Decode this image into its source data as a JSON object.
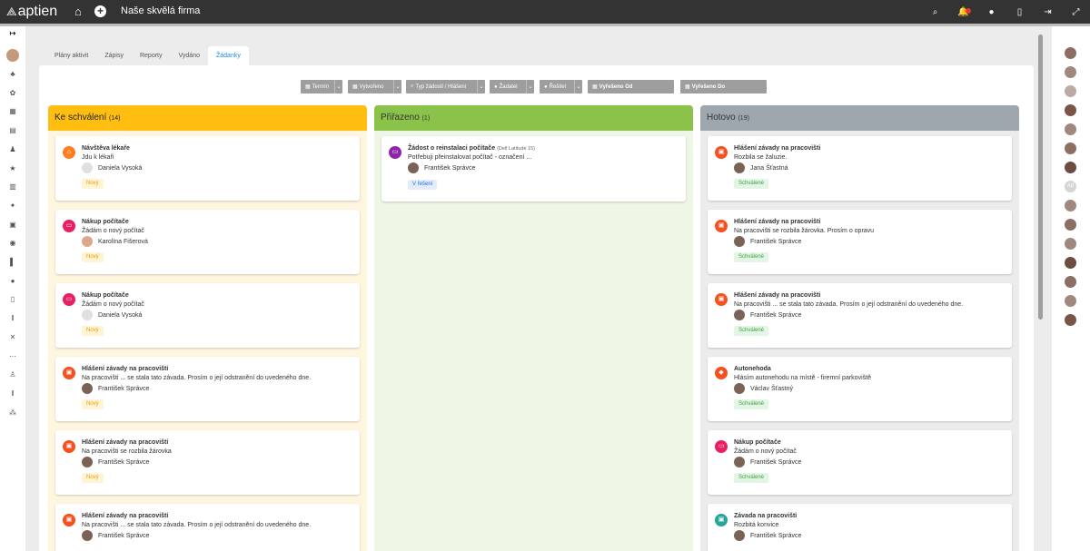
{
  "app": {
    "logo": "aptien",
    "company": "Naše skvělá firma"
  },
  "topbar": {
    "icons": [
      "search-icon",
      "notifications-icon",
      "chat-icon",
      "mobile-icon",
      "logout-icon",
      "fullscreen-icon"
    ]
  },
  "tabs": [
    {
      "label": "Plány aktivit"
    },
    {
      "label": "Zápisy"
    },
    {
      "label": "Reporty"
    },
    {
      "label": "Vydáno"
    },
    {
      "label": "Žádanky",
      "active": true
    }
  ],
  "filters": [
    {
      "label": "Termín",
      "icon": "calendar-icon"
    },
    {
      "label": "Vytvořeno",
      "icon": "calendar-icon"
    },
    {
      "label": "Typ žádostí / Hlášení",
      "icon": "search-icon"
    },
    {
      "label": "Žadatel",
      "icon": "user-icon"
    },
    {
      "label": "Řešitel",
      "icon": "user-icon"
    },
    {
      "label": "Vyřešeno Od",
      "icon": "calendar-icon"
    },
    {
      "label": "Vyřešeno Do",
      "icon": "calendar-icon"
    }
  ],
  "columns": [
    {
      "title": "Ke schválení",
      "count": "(14)",
      "color": "#ffbe10",
      "bg": "#fff6e0",
      "cards": [
        {
          "title": "Návštěva lékaře",
          "desc": "Jdu k lékaři",
          "user": "Daniela Vysoká",
          "badge": "Nový",
          "badge_type": "novy",
          "icon_color": "#ff7e21",
          "icon": "home-icon",
          "glyph": "⌂"
        },
        {
          "title": "Nákup počítače",
          "desc": "Žádám o nový počítač",
          "user": "Karolína Fišerová",
          "badge": "Nový",
          "badge_type": "novy",
          "icon_color": "#e91e63",
          "icon": "computer-icon",
          "glyph": "▭"
        },
        {
          "title": "Nákup počítače",
          "desc": "Žádám o nový počítač",
          "user": "Daniela Vysoká",
          "badge": "Nový",
          "badge_type": "novy",
          "icon_color": "#e91e63",
          "icon": "computer-icon",
          "glyph": "▭"
        },
        {
          "title": "Hlášení závady na pracovišti",
          "desc": "Na pracovišti ... se stala tato závada. Prosím o její odstranění do uvedeného dne.",
          "user": "František Správce",
          "badge": "Nový",
          "badge_type": "novy",
          "icon_color": "#f4511e",
          "icon": "truck-icon",
          "glyph": "▣"
        },
        {
          "title": "Hlášení závady na pracovišti",
          "desc": "Na pracovišti se rozbila žárovka",
          "user": "František Správce",
          "badge": "Nový",
          "badge_type": "novy",
          "icon_color": "#f4511e",
          "icon": "truck-icon",
          "glyph": "▣"
        },
        {
          "title": "Hlášení závady na pracovišti",
          "desc": "Na pracovišti ... se stala tato závada. Prosím o její odstranění do uvedeného dne.",
          "user": "František Správce",
          "badge": "",
          "badge_type": "novy",
          "icon_color": "#f4511e",
          "icon": "truck-icon",
          "glyph": "▣"
        }
      ]
    },
    {
      "title": "Přiřazeno",
      "count": "(1)",
      "color": "#8bc34a",
      "bg": "#eef6e6",
      "cards": [
        {
          "title": "Žádost o reinstalaci počítače",
          "subtitle": "(Dell Latitude 15)",
          "desc": "Potřebuji přeinstalovat počítač - označení ...",
          "user": "František Správce",
          "badge": "V řešení",
          "badge_type": "resi",
          "icon_color": "#8e24aa",
          "icon": "computer-icon",
          "glyph": "▭"
        }
      ]
    },
    {
      "title": "Hotovo",
      "count": "(19)",
      "color": "#9ea7ad",
      "bg": "#ececec",
      "cards": [
        {
          "title": "Hlášení závady na pracovišti",
          "desc": "Rozbila se žaluzie.",
          "user": "Jana Šťastná",
          "badge": "Schválené",
          "badge_type": "schv",
          "icon_color": "#f4511e",
          "icon": "truck-icon",
          "glyph": "▣"
        },
        {
          "title": "Hlášení závady na pracovišti",
          "desc": "Na pracovišti se rozbila žárovka. Prosím o opravu",
          "user": "František Správce",
          "badge": "Schválené",
          "badge_type": "schv",
          "icon_color": "#f4511e",
          "icon": "truck-icon",
          "glyph": "▣"
        },
        {
          "title": "Hlášení závady na pracovišti",
          "desc": "Na pracovišti ... se stala tato závada. Prosím o její odstranění do uvedeného dne.",
          "user": "František Správce",
          "badge": "Schválené",
          "badge_type": "schv",
          "icon_color": "#f4511e",
          "icon": "truck-icon",
          "glyph": "▣"
        },
        {
          "title": "Autonehoda",
          "desc": "Hlásím autonehodu na místě - firemní parkoviště",
          "user": "Václav Šťastný",
          "badge": "Schválené",
          "badge_type": "schv",
          "icon_color": "#f4511e",
          "icon": "car-icon",
          "glyph": "◆"
        },
        {
          "title": "Nákup počítače",
          "desc": "Žádám o nový počítač",
          "user": "František Správce",
          "badge": "Schválené",
          "badge_type": "schv",
          "icon_color": "#e91e63",
          "icon": "computer-icon",
          "glyph": "▭"
        },
        {
          "title": "Závada na pracovišti",
          "desc": "Rozbitá konvice",
          "user": "František Správce",
          "badge": "",
          "badge_type": "schv",
          "icon_color": "#26a69a",
          "icon": "truck-icon",
          "glyph": "▣"
        }
      ]
    }
  ],
  "sidebar_icons": [
    "expand-icon",
    "tree-icon",
    "sprout-icon",
    "calendar-icon",
    "building-icon",
    "people-icon",
    "star-icon",
    "document-icon",
    "dog-icon",
    "clipboard-icon",
    "badge-icon",
    "book-icon",
    "person-icon",
    "trash-icon",
    "books-icon",
    "tools-icon",
    "grid-icon",
    "group-icon",
    "library-icon",
    "org-chart-icon"
  ],
  "right_avatars": [
    "#8d6e63",
    "#a1887f",
    "#bcaaa4",
    "#795548",
    "#a1887f",
    "#8d6e63",
    "#6d4c41",
    "#bdbdbd",
    "#a1887f",
    "#8d6e63",
    "#a1887f",
    "#6d4c41",
    "#8d6e63",
    "#a1887f",
    "#795548"
  ],
  "right_avatar_label": "Ad"
}
